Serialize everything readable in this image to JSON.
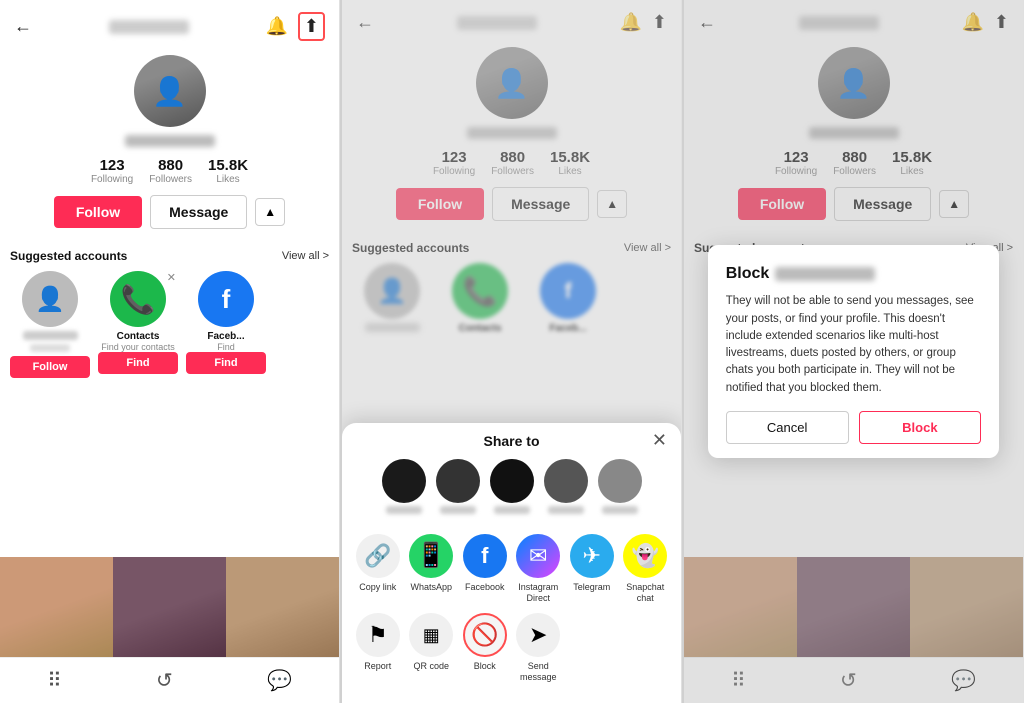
{
  "panel1": {
    "nav": {
      "back_icon": "←",
      "share_icon": "⬆",
      "bell_icon": "🔔",
      "share_box_icon": "⬆"
    },
    "profile": {
      "stats": [
        {
          "num": "123",
          "label": "Following"
        },
        {
          "num": "880",
          "label": "Followers"
        },
        {
          "num": "15.8K",
          "label": "Likes"
        }
      ],
      "follow_btn": "Follow",
      "message_btn": "Message"
    },
    "suggested": {
      "title": "Suggested accounts",
      "view_all": "View all >",
      "cards": [
        {
          "type": "person",
          "follow_btn": "Follow"
        },
        {
          "type": "contacts",
          "label": "Contacts",
          "sub": "Find your contacts",
          "find_btn": "Find"
        },
        {
          "type": "facebook",
          "label": "Faceb...",
          "sub": "Find"
        }
      ]
    }
  },
  "panel2": {
    "nav": {
      "back_icon": "←",
      "bell_icon": "🔔",
      "share_icon": "⬆"
    },
    "profile": {
      "stats": [
        {
          "num": "123",
          "label": "Following"
        },
        {
          "num": "880",
          "label": "Followers"
        },
        {
          "num": "15.8K",
          "label": "Likes"
        }
      ],
      "follow_btn": "Follow",
      "message_btn": "Message"
    },
    "share_modal": {
      "title": "Share to",
      "close_icon": "✕",
      "apps": [
        {
          "id": "copy-link",
          "label": "Copy link",
          "icon": "🔗",
          "style": "gray"
        },
        {
          "id": "whatsapp",
          "label": "WhatsApp",
          "icon": "✆",
          "style": "whatsapp"
        },
        {
          "id": "facebook",
          "label": "Facebook",
          "icon": "f",
          "style": "facebook"
        },
        {
          "id": "instagram-direct",
          "label": "Instagram Direct",
          "icon": "✉",
          "style": "messenger"
        },
        {
          "id": "telegram",
          "label": "Telegram",
          "icon": "✈",
          "style": "telegram"
        },
        {
          "id": "snapchat",
          "label": "Snapchat chat",
          "icon": "👻",
          "style": "snapchat"
        },
        {
          "id": "report",
          "label": "Report",
          "icon": "⚑",
          "style": "gray"
        },
        {
          "id": "qr-code",
          "label": "QR code",
          "icon": "▦",
          "style": "gray"
        },
        {
          "id": "block",
          "label": "Block",
          "icon": "🚫",
          "style": "block-highlighted"
        },
        {
          "id": "send-message",
          "label": "Send message",
          "icon": "➤",
          "style": "gray"
        }
      ]
    }
  },
  "panel3": {
    "nav": {
      "back_icon": "←",
      "bell_icon": "🔔",
      "share_icon": "⬆"
    },
    "profile": {
      "stats": [
        {
          "num": "123",
          "label": "Following"
        },
        {
          "num": "880",
          "label": "Followers"
        },
        {
          "num": "15.8K",
          "label": "Likes"
        }
      ],
      "follow_btn": "Follow",
      "message_btn": "Message"
    },
    "suggested": {
      "title": "Suggested accounts",
      "view_all": "View all >"
    },
    "block_dialog": {
      "title": "Block",
      "body": "They will not be able to send you messages, see your posts, or find your profile. This doesn't include extended scenarios like multi-host livestreams, duets posted by others, or group chats you both participate in. They will not be notified that you blocked them.",
      "cancel_btn": "Cancel",
      "block_btn": "Block"
    }
  },
  "colors": {
    "red": "#fe2c55",
    "green": "#1cb84b",
    "blue": "#1877f2"
  }
}
